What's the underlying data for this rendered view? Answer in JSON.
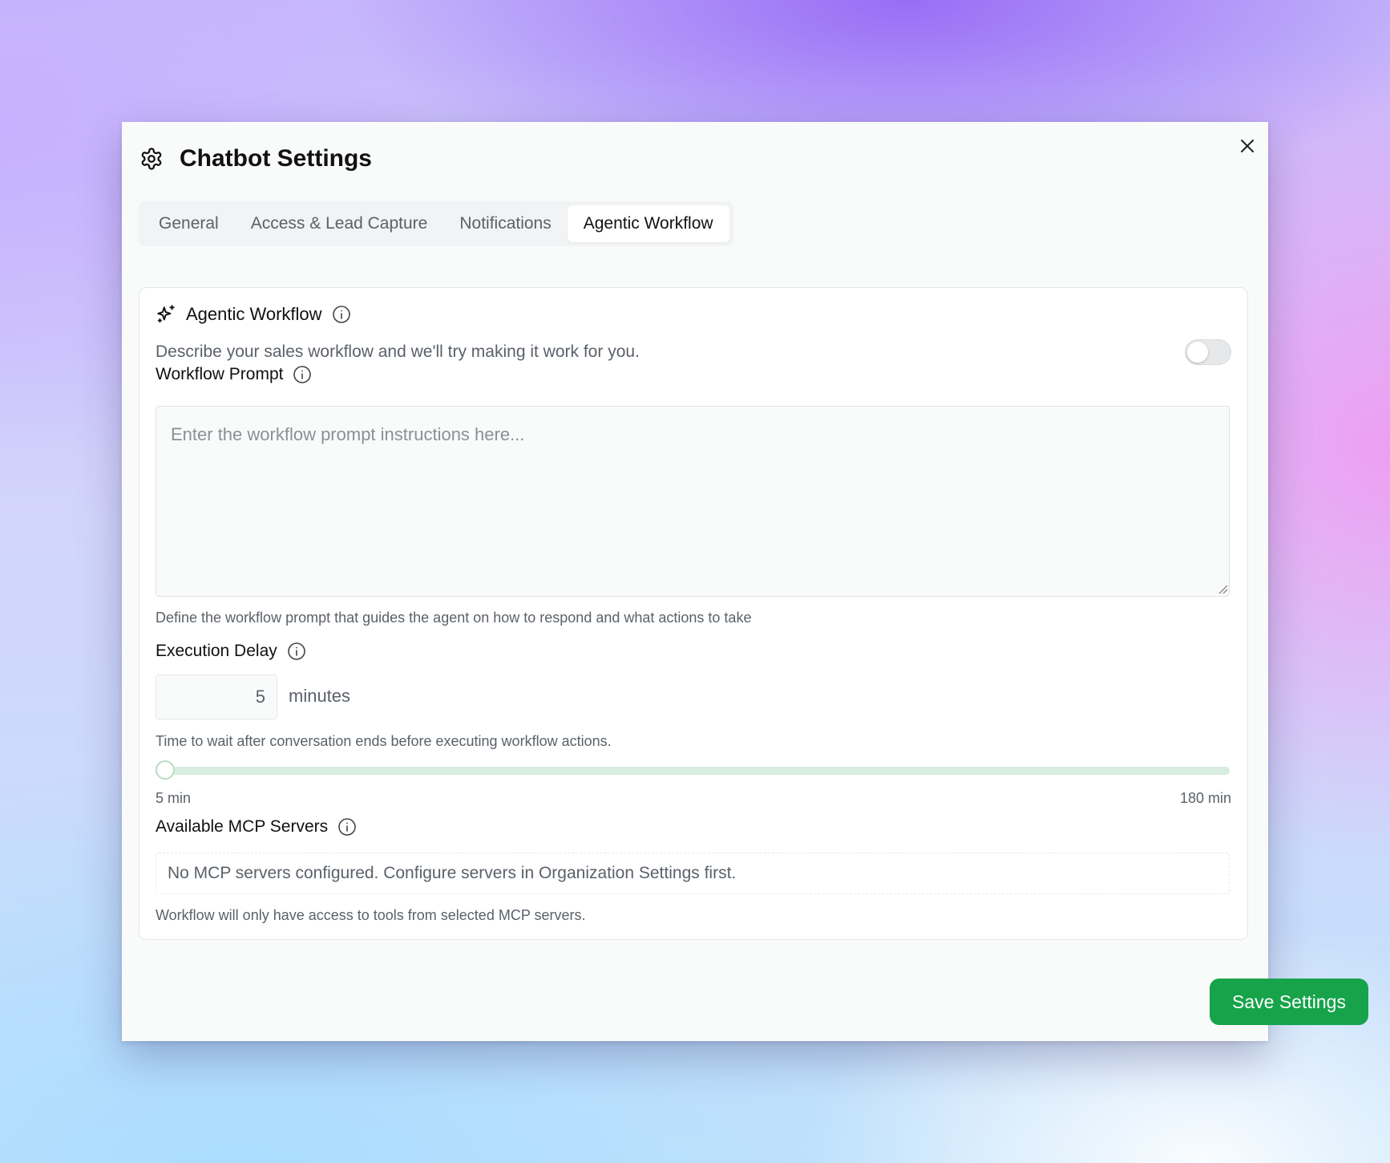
{
  "dialog": {
    "title": "Chatbot Settings",
    "icon": "gear-icon",
    "close_icon": "close-icon"
  },
  "tabs": [
    {
      "label": "General",
      "active": false
    },
    {
      "label": "Access & Lead Capture",
      "active": false
    },
    {
      "label": "Notifications",
      "active": false
    },
    {
      "label": "Agentic Workflow",
      "active": true
    }
  ],
  "agentic": {
    "icon": "sparkles-icon",
    "title": "Agentic Workflow",
    "description": "Describe your sales workflow and we'll try making it work for you.",
    "enabled": false
  },
  "workflow_prompt": {
    "label": "Workflow Prompt",
    "value": "",
    "placeholder": "Enter the workflow prompt instructions here...",
    "hint": "Define the workflow prompt that guides the agent on how to respond and what actions to take"
  },
  "execution_delay": {
    "label": "Execution Delay",
    "value": "5",
    "unit": "minutes",
    "hint": "Time to wait after conversation ends before executing workflow actions.",
    "min": 5,
    "max": 180,
    "min_label": "5 min",
    "max_label": "180 min"
  },
  "mcp": {
    "label": "Available MCP Servers",
    "empty_message": "No MCP servers configured. Configure servers in Organization Settings first.",
    "hint": "Workflow will only have access to tools from selected MCP servers."
  },
  "footer": {
    "save_label": "Save Settings"
  },
  "colors": {
    "accent": "#16a34a",
    "slider_track": "#d8ecdf"
  }
}
